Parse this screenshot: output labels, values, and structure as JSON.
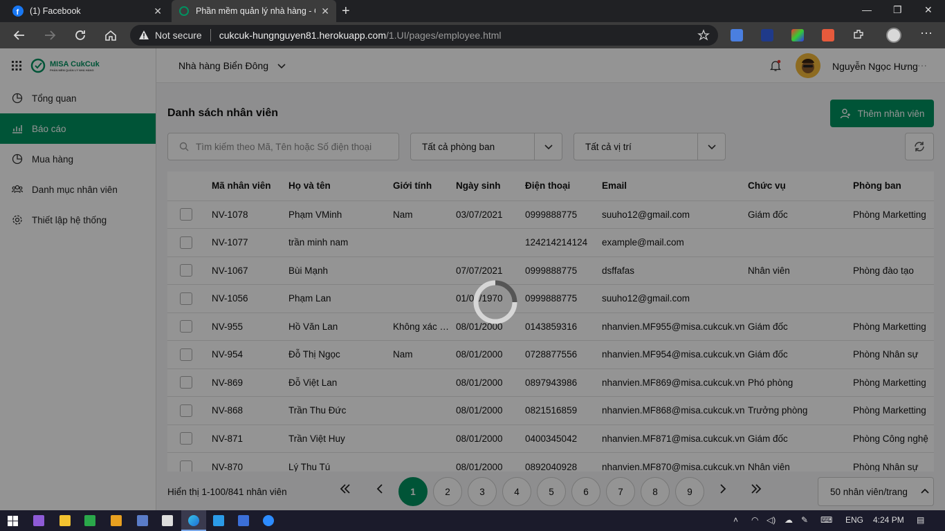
{
  "browser": {
    "tabs": [
      {
        "title": "(1) Facebook"
      },
      {
        "title": "Phần mềm quản lý nhà hàng - C"
      }
    ],
    "security_label": "Not secure",
    "url_domain": "cukcuk-hungnguyen81.herokuapp.com",
    "url_path": "/1.UI/pages/employee.html"
  },
  "sidebar": {
    "logo_text": "MISA CukCuk",
    "logo_sub": "PHẦN MỀM QUẢN LÝ NHÀ HÀNG",
    "items": [
      {
        "label": "Tổng quan",
        "icon": "pie-chart-icon"
      },
      {
        "label": "Báo cáo",
        "icon": "bar-chart-icon"
      },
      {
        "label": "Mua hàng",
        "icon": "pie-chart-icon"
      },
      {
        "label": "Danh mục nhân viên",
        "icon": "people-icon"
      },
      {
        "label": "Thiết lập hệ thống",
        "icon": "gear-icon"
      }
    ],
    "active_index": 1
  },
  "header": {
    "restaurant": "Nhà hàng Biển Đông",
    "user_name": "Nguyễn Ngọc Hưng"
  },
  "main": {
    "title": "Danh sách nhân viên",
    "add_button": "Thêm nhân viên",
    "search_placeholder": "Tìm kiếm theo Mã, Tên hoặc Số điện thoại",
    "dept_filter": "Tất cả phòng ban",
    "position_filter": "Tất cả vị trí"
  },
  "table": {
    "columns": [
      "Mã nhân viên",
      "Họ và tên",
      "Giới tính",
      "Ngày sinh",
      "Điện thoại",
      "Email",
      "Chức vụ",
      "Phòng ban"
    ],
    "rows": [
      [
        "NV-1078",
        "Phạm VMinh",
        "Nam",
        "03/07/2021",
        "0999888775",
        "suuho12@gmail.com",
        "Giám đốc",
        "Phòng Marketting"
      ],
      [
        "NV-1077",
        "trần minh nam",
        "",
        "",
        "124214214124",
        "example@mail.com",
        "",
        ""
      ],
      [
        "NV-1067",
        "Bùi Mạnh",
        "",
        "07/07/2021",
        "0999888775",
        "dsffafas",
        "Nhân viên",
        "Phòng đào tạo"
      ],
      [
        "NV-1056",
        "Phạm Lan",
        "",
        "01/01/1970",
        "0999888775",
        "suuho12@gmail.com",
        "",
        ""
      ],
      [
        "NV-955",
        "Hồ Văn Lan",
        "Không xác định",
        "08/01/2000",
        "0143859316",
        "nhanvien.MF955@misa.cukcuk.vn",
        "Giám đốc",
        "Phòng Marketting"
      ],
      [
        "NV-954",
        "Đỗ Thị Ngọc",
        "Nam",
        "08/01/2000",
        "0728877556",
        "nhanvien.MF954@misa.cukcuk.vn",
        "Giám đốc",
        "Phòng Nhân sự"
      ],
      [
        "NV-869",
        "Đỗ Việt Lan",
        "",
        "08/01/2000",
        "0897943986",
        "nhanvien.MF869@misa.cukcuk.vn",
        "Phó phòng",
        "Phòng Marketting"
      ],
      [
        "NV-868",
        "Trần Thu Đức",
        "",
        "08/01/2000",
        "0821516859",
        "nhanvien.MF868@misa.cukcuk.vn",
        "Trưởng phòng",
        "Phòng Marketting"
      ],
      [
        "NV-871",
        "Trần Việt Huy",
        "",
        "08/01/2000",
        "0400345042",
        "nhanvien.MF871@misa.cukcuk.vn",
        "Giám đốc",
        "Phòng Công nghệ"
      ],
      [
        "NV-870",
        "Lý Thu Tú",
        "",
        "08/01/2000",
        "0892040928",
        "nhanvien.MF870@misa.cukcuk.vn",
        "Nhân viên",
        "Phòng Nhân sự"
      ]
    ]
  },
  "footer": {
    "paging_info": "Hiển thị 1-100/841 nhân viên",
    "pages": [
      "1",
      "2",
      "3",
      "4",
      "5",
      "6",
      "7",
      "8",
      "9"
    ],
    "current_page": "1",
    "page_size": "50 nhân viên/trang"
  },
  "taskbar": {
    "lang": "ENG",
    "time": "4:24 PM"
  },
  "colors": {
    "brand": "#019160",
    "overlay": "#000000"
  }
}
